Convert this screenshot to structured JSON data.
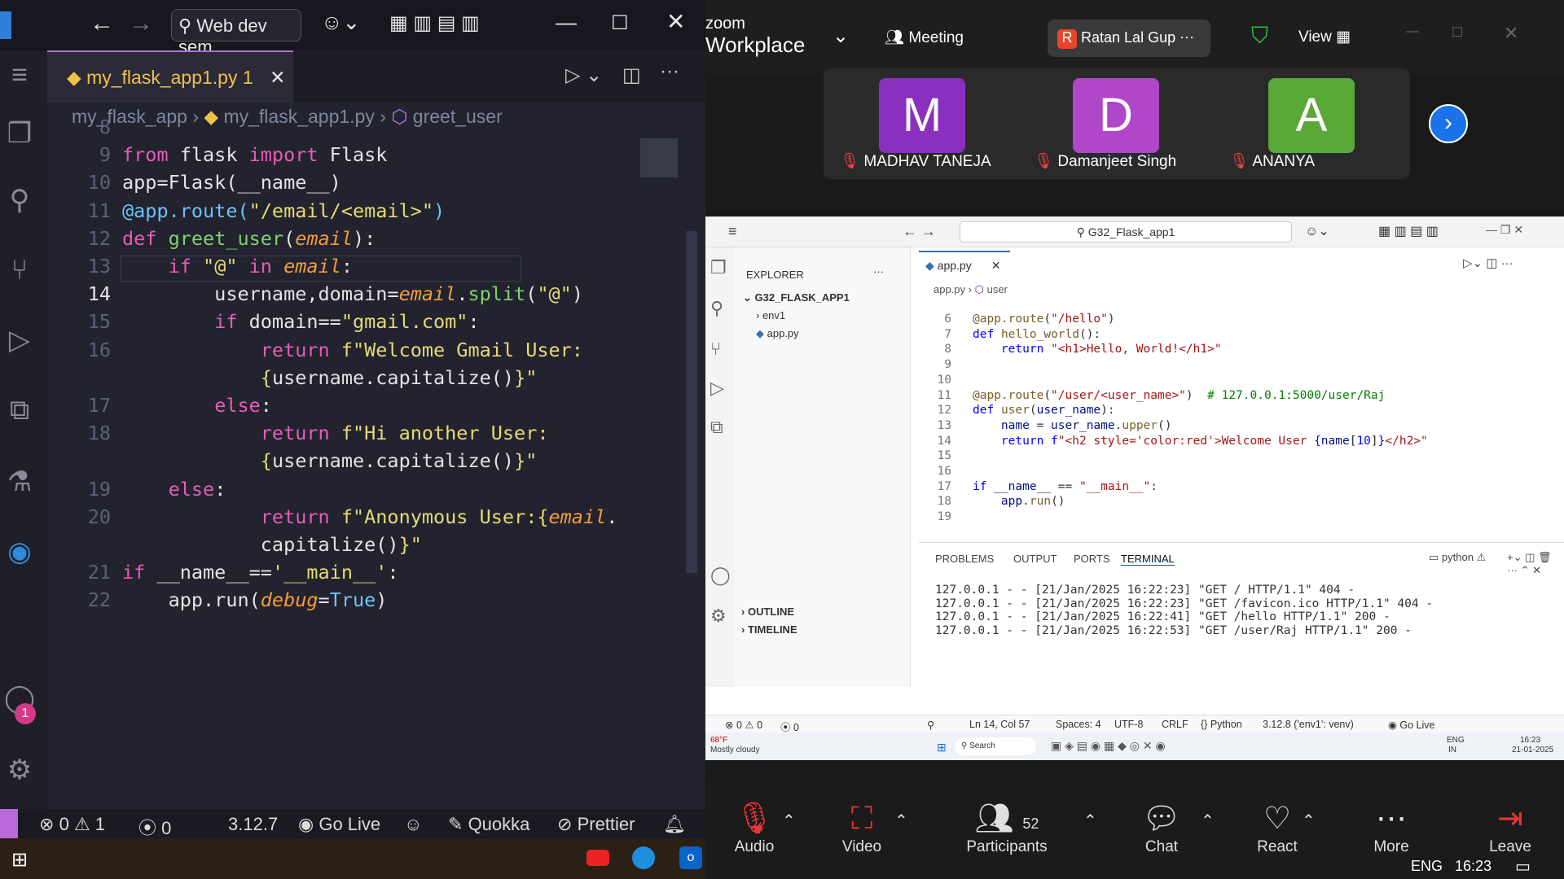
{
  "left_editor": {
    "title_bar": {
      "search_text": "Web dev sem"
    },
    "tab": {
      "filename": "my_flask_app1.py",
      "badge": "1"
    },
    "breadcrumb": {
      "folder": "my_flask_app",
      "file": "my_flask_app1.py",
      "symbol": "greet_user"
    },
    "code_lines": [
      {
        "n": "8",
        "html": ""
      },
      {
        "n": "9",
        "html": "<span class='kw'>from</span> flask <span class='kw'>import</span> Flask"
      },
      {
        "n": "10",
        "html": "app=Flask(__name__)"
      },
      {
        "n": "11",
        "html": "<span class='de'>@app.route(</span><span class='st'>\"/email/&lt;email&gt;\"</span><span class='de'>)</span>"
      },
      {
        "n": "12",
        "html": "<span class='kw'>def</span> <span class='fn'>greet_user</span>(<span class='pa'>email</span>):"
      },
      {
        "n": "13",
        "html": "    <span class='kw'>if</span> <span class='st'>\"@\"</span> <span class='kw'>in</span> <span class='pa'>email</span>:"
      },
      {
        "n": "14",
        "html": "        username,domain=<span class='pa'>email</span>.<span class='fn'>split</span>(<span class='st'>\"@\"</span>)"
      },
      {
        "n": "15",
        "html": "        <span class='kw'>if</span> domain==<span class='st'>\"gmail.com\"</span>:"
      },
      {
        "n": "16",
        "html": "            <span class='kw'>return</span> <span class='st'>f\"Welcome Gmail User:</span>"
      },
      {
        "n": "",
        "html": "            <span class='st'>{</span>username.capitalize()<span class='st'>}\"</span>"
      },
      {
        "n": "17",
        "html": "        <span class='kw'>else</span>:"
      },
      {
        "n": "18",
        "html": "            <span class='kw'>return</span> <span class='st'>f\"Hi another User:</span>"
      },
      {
        "n": "",
        "html": "            <span class='st'>{</span>username.capitalize()<span class='st'>}\"</span>"
      },
      {
        "n": "19",
        "html": "    <span class='kw'>else</span>:"
      },
      {
        "n": "20",
        "html": "            <span class='kw'>return</span> <span class='st'>f\"Anonymous User:{</span><span class='pa'>email</span>."
      },
      {
        "n": "",
        "html": "            capitalize()<span class='st'>}\"</span>"
      },
      {
        "n": "21",
        "html": "<span class='kw'>if</span> __name__==<span class='st'>'__main__'</span>:"
      },
      {
        "n": "22",
        "html": "    app.run(<span class='pa'>debug</span>=<span class='de'>True</span>)"
      }
    ],
    "status": {
      "errors": "0",
      "warnings": "1",
      "ports": "0",
      "python": "3.12.7",
      "golive": "Go Live",
      "quokka": "Quokka",
      "prettier": "Prettier"
    }
  },
  "zoom": {
    "brand1": "zoom",
    "brand2": "Workplace",
    "meeting": "Meeting",
    "host": "Ratan Lal Gup",
    "host_initial": "R",
    "view": "View",
    "participants": [
      {
        "initial": "M",
        "name": "MADHAV TANEJA",
        "color": "#8b2fbf"
      },
      {
        "initial": "D",
        "name": "Damanjeet Singh",
        "color": "#b046c8"
      },
      {
        "initial": "A",
        "name": "ANANYA",
        "color": "#5aa83a"
      }
    ],
    "toolbar": {
      "audio": "Audio",
      "video": "Video",
      "participants": "Participants",
      "participant_count": "52",
      "chat": "Chat",
      "react": "React",
      "more": "More",
      "leave": "Leave"
    }
  },
  "shared": {
    "search": "G32_Flask_app1",
    "explorer_title": "EXPLORER",
    "project": "G32_FLASK_APP1",
    "tree": [
      "env1",
      "app.py"
    ],
    "tab": "app.py",
    "crumb_file": "app.py",
    "crumb_symbol": "user",
    "code": [
      {
        "n": "6",
        "html": "<span class='rd'>@app.route</span>(<span class='rs'>\"/hello\"</span>)"
      },
      {
        "n": "7",
        "html": "<span class='rk'>def</span> <span class='rf'>hello_world</span>():"
      },
      {
        "n": "8",
        "html": "    <span class='rk'>return</span> <span class='rs'>\"&lt;h1&gt;Hello, World!&lt;/h1&gt;\"</span>"
      },
      {
        "n": "9",
        "html": ""
      },
      {
        "n": "10",
        "html": ""
      },
      {
        "n": "11",
        "html": "<span class='rd'>@app.route</span>(<span class='rs'>\"/user/&lt;user_name&gt;\"</span>)  <span class='rc'># 127.0.0.1:5000/user/Raj</span>"
      },
      {
        "n": "12",
        "html": "<span class='rk'>def</span> <span class='rf'>user</span>(<span class='rv'>user_name</span>):"
      },
      {
        "n": "13",
        "html": "    <span class='rv'>name</span> = <span class='rv'>user_name</span>.<span class='rf'>upper</span>()"
      },
      {
        "n": "14",
        "html": "    <span class='rk'>return</span> <span class='rk'>f</span><span class='rs'>\"&lt;h2 style='color:red'&gt;Welcome User </span><span class='rk'>{</span><span class='rv'>name</span>[<span class='rk'>10</span>]<span class='rk'>}</span><span class='rs'>&lt;/h2&gt;\"</span>"
      },
      {
        "n": "15",
        "html": ""
      },
      {
        "n": "16",
        "html": ""
      },
      {
        "n": "17",
        "html": "<span class='rk'>if</span> <span class='rv'>__name__</span> == <span class='rs'>\"__main__\"</span>:"
      },
      {
        "n": "18",
        "html": "    <span class='rv'>app</span>.<span class='rf'>run</span>()"
      },
      {
        "n": "19",
        "html": ""
      }
    ],
    "panel_tabs": [
      "PROBLEMS",
      "OUTPUT",
      "PORTS",
      "TERMINAL"
    ],
    "terminal_label": "python",
    "terminal": [
      "127.0.0.1 - - [21/Jan/2025 16:22:23] \"GET / HTTP/1.1\" 404 -",
      "127.0.0.1 - - [21/Jan/2025 16:22:23] \"GET /favicon.ico HTTP/1.1\" 404 -",
      "127.0.0.1 - - [21/Jan/2025 16:22:41] \"GET /hello HTTP/1.1\" 200 -",
      "127.0.0.1 - - [21/Jan/2025 16:22:53] \"GET /user/Raj HTTP/1.1\" 200 -"
    ],
    "outline": "OUTLINE",
    "timeline": "TIMELINE",
    "status": {
      "errors": "0",
      "warnings": "0",
      "ports": "0",
      "pos": "Ln 14, Col 57",
      "spaces": "Spaces: 4",
      "enc": "UTF-8",
      "eol": "CRLF",
      "lang": "Python",
      "interp": "3.12.8 ('env1': venv)",
      "golive": "Go Live"
    },
    "weather_temp": "68°F",
    "weather_desc": "Mostly cloudy",
    "taskbar_search": "Search",
    "lang_line1": "ENG",
    "lang_line2": "IN",
    "clock_time": "16:23",
    "clock_date": "21-01-2025"
  },
  "taskbar": {
    "lang": "ENG",
    "time": "16:23"
  }
}
